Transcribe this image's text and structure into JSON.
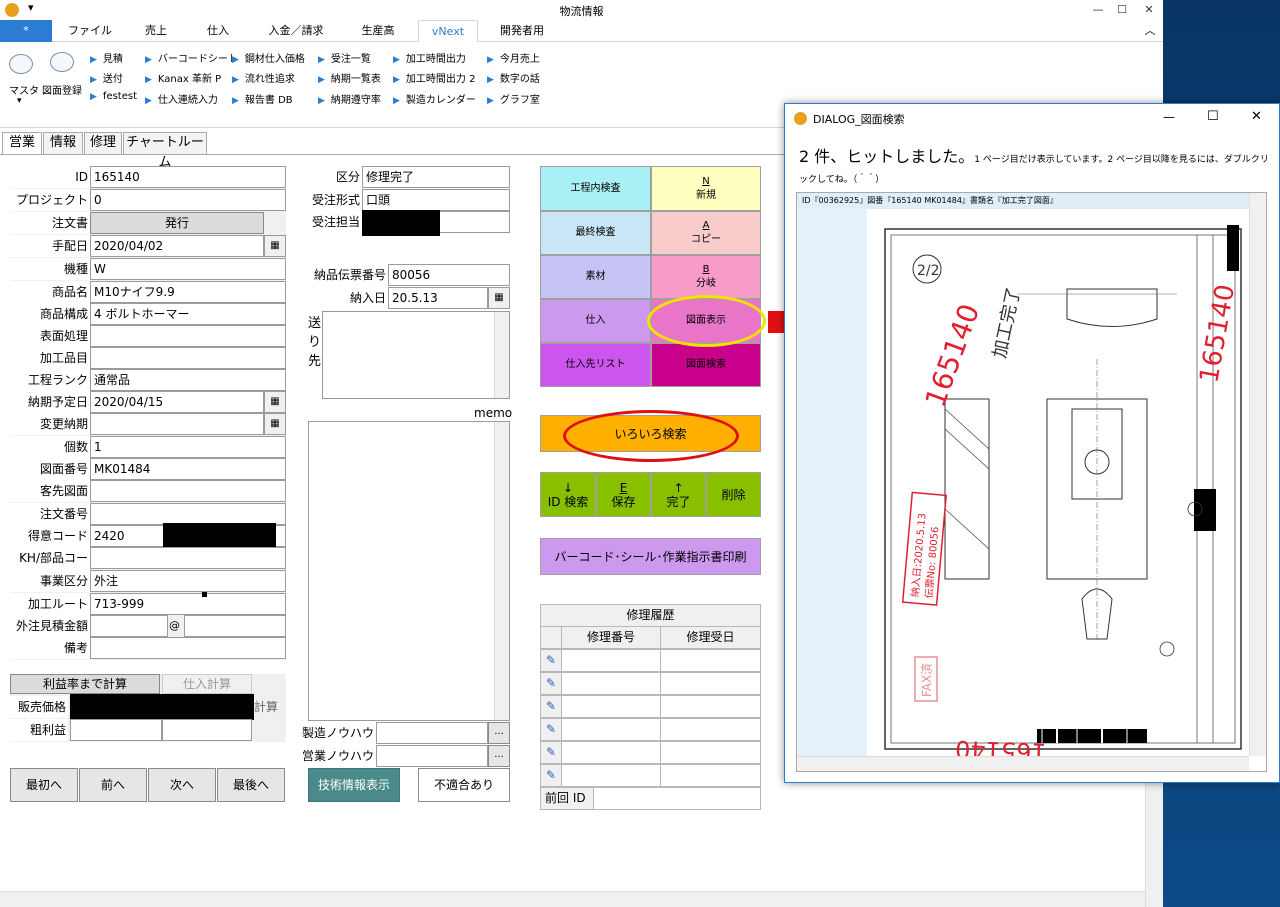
{
  "window": {
    "title": "物流情報",
    "min": "—",
    "max": "☐",
    "close": "✕"
  },
  "ribbon_tabs": [
    "*",
    "ファイル",
    "売上",
    "仕入",
    "入金／請求",
    "生産高",
    "vNext",
    "開発者用"
  ],
  "ribbon": {
    "masta": "マスタ",
    "zumen_touroku": "図面登録",
    "links": [
      [
        "見積",
        "送付",
        "festest"
      ],
      [
        "バーコードシート",
        "Kanax 革新 P",
        "仕入連続入力"
      ],
      [
        "鋼材仕入価格",
        "流れ性追求",
        "報告書 DB"
      ],
      [
        "受注一覧",
        "納期一覧表",
        "納期遵守率"
      ],
      [
        "加工時間出力",
        "加工時間出力 2",
        "製造カレンダー"
      ],
      [
        "今月売上",
        "数字の話",
        "グラフ室"
      ]
    ],
    "collapse": "︿"
  },
  "app_tabs": [
    "営業",
    "情報",
    "修理",
    "チャートルーム"
  ],
  "form": {
    "labels": [
      "ID",
      "プロジェクト",
      "注文書",
      "手配日",
      "機種",
      "商品名",
      "商品構成",
      "表面処理",
      "加工品目",
      "工程ランク",
      "納期予定日",
      "変更納期",
      "個数",
      "図面番号",
      "客先図面",
      "注文番号",
      "得意コード",
      "KH/部品コード",
      "事業区分",
      "加工ルート",
      "外注見積金額",
      "備考"
    ],
    "id": "165140",
    "project": "0",
    "order_button": "発行",
    "arrange_date": "2020/04/02",
    "model": "W",
    "product_name": "M10ナイフ9.9",
    "product_config": "4 ボルトホーマー",
    "surface": "",
    "process_item": "",
    "rank": "通常品",
    "due_date": "2020/04/15",
    "changed_due": "",
    "qty": "1",
    "drawing_no": "MK01484",
    "client_drawing": "",
    "order_no": "",
    "customer_code": "2420",
    "kh_code": "",
    "business": "外注",
    "route": "713-999",
    "outsource_at": "@",
    "notes": ""
  },
  "calc": {
    "profit_tab": "利益率まで計算",
    "purchase_tab": "仕入計算",
    "calc_label": "計算",
    "sale_price": "販売価格",
    "gross": "粗利益"
  },
  "nav": [
    "最初へ",
    "前へ",
    "次へ",
    "最後へ"
  ],
  "mid": {
    "kubun_label": "区分",
    "kubun": "修理完了",
    "juchu_label": "受注形式",
    "juchu": "口頭",
    "tanto_label": "受注担当",
    "denpyo_label": "納品伝票番号",
    "denpyo": "80056",
    "nyuka_label": "納入日",
    "nyuka": "20.5.13",
    "okuri_label": "送り先",
    "memo_label": "memo",
    "seizo_label": "製造ノウハウ",
    "eigyo_label": "営業ノウハウ",
    "dots": "...",
    "tech_btn": "技術情報表示",
    "nonconf_btn": "不適合あり"
  },
  "menu": {
    "kotei": "工程内検査",
    "saishu": "最終検査",
    "sozai": "素材",
    "shiire": "仕入",
    "shiiresaki": "仕入先リスト",
    "new_key": "N",
    "new": "新規",
    "copy_key": "A",
    "copy": "コピー",
    "branch_key": "B",
    "branch": "分岐",
    "zumen_hyouji": "図面表示",
    "zumen_kensaku": "図面検索",
    "iroiro": "いろいろ検索",
    "id_search_arr": "↓",
    "id_search": "ID 検索",
    "save_key": "E",
    "save": "保存",
    "done_arr": "↑",
    "done": "完了",
    "delete": "削除",
    "print": "バーコード･シール･作業指示書印刷"
  },
  "history": {
    "title": "修理履歴",
    "col1": "修理番号",
    "col2": "修理受日",
    "prev_id": "前回 ID",
    "rows": 6
  },
  "dialog": {
    "title": "DIALOG_図面検索",
    "hit": "2 件、ヒットしました。",
    "hint": "1 ページ目だけ表示しています。2 ページ目以降を見るには、ダブルクリックしてね。（＾＾）",
    "item": "ID『00362925』図番『165140 MK01484』書類名『加工完了図面』",
    "drawing": {
      "num1": "165140",
      "num2": "165140",
      "num3": "165140",
      "stamp_fax": "FAX済",
      "stamp_date": "納入日:2020.5.13",
      "stamp_slip": "伝票No: 80056",
      "sum": "加工完了",
      "sheet": "2/2"
    }
  },
  "colors": {
    "accent": "#2b7cd3",
    "kotei": "#a8f0f4",
    "saishu": "#c9e6f7",
    "sozai": "#c8c3f5",
    "shiire": "#cc99ee",
    "shiiresaki": "#cc55ee",
    "new": "#ffffc0",
    "copy": "#f9cccc",
    "branch": "#f79bc8",
    "zumen_h": "#e875c8",
    "zumen_k": "#c8008c",
    "iroiro": "#ffb000",
    "green": "#88c000",
    "print": "#cc99ee",
    "tech": "#4a8a8a"
  }
}
